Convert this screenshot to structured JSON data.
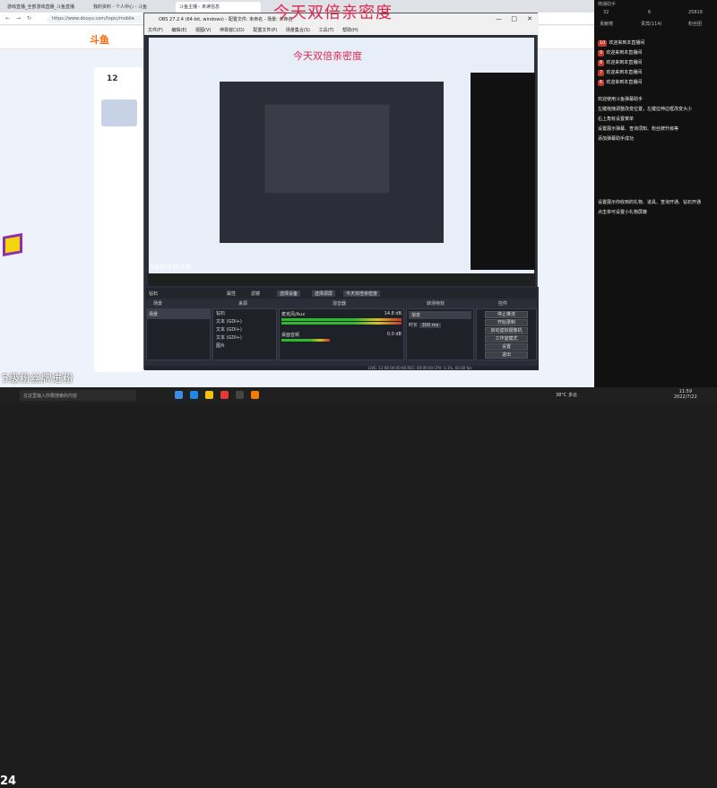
{
  "browser": {
    "tabs": [
      "游戏直播_全部游戏直播_斗鱼直播",
      "我的资料 - 个人中心 - 斗鱼",
      "斗鱼主播 - 未读信息"
    ],
    "url": "https://www.douyu.com/topic/mobile",
    "site_logo": "斗鱼",
    "card_number": "12"
  },
  "overlay": {
    "title": "今天双倍亲密度",
    "fans_banner": "5级粉丝牌进粉",
    "corner_number": "24"
  },
  "obs": {
    "title": "OBS 27.2.4 (64-bit, windows) - 配置文件: 未命名 - 场景: 未命名",
    "menu": [
      "文件(F)",
      "编辑(E)",
      "视图(V)",
      "停靠窗口(D)",
      "配置文件(P)",
      "场景集合(S)",
      "工具(T)",
      "帮助(H)"
    ],
    "preview_caption": "今天双倍亲密度",
    "preview_fans": "5级粉丝牌进粉",
    "toolbar": {
      "label": "钻石",
      "props": "属性",
      "filters": "滤镜",
      "transition_a": "选择设备",
      "transition_b": "选择源屏",
      "ext": "今天双倍亲密度"
    },
    "docks": {
      "scenes": "场景",
      "sources": "来源",
      "mixer": "混音器",
      "transitions": "转场特效",
      "controls": "控件"
    },
    "scene_item": "场景",
    "sources": [
      "钻石",
      "文本 (GDI+)",
      "文本 (GDI+)",
      "文本 (GDI+)",
      "图片"
    ],
    "mixer": [
      {
        "name": "麦克风/Aux",
        "db": "14.8 dB"
      },
      {
        "name": "桌面音频",
        "db": "0.0 dB"
      }
    ],
    "transition": {
      "type": "渐变",
      "duration_label": "时长",
      "duration": "300 ms"
    },
    "buttons": [
      "停止推流",
      "开始录制",
      "启动虚拟摄像机",
      "工作室模式",
      "设置",
      "退出"
    ],
    "status": "LIVE: 12:08  00:00:00   REC: 00:00:00   CPU: 3.1%, 60.00 fps"
  },
  "chat": {
    "header": "微播助手",
    "counts": [
      "32",
      "6",
      "25818"
    ],
    "tabs": [
      "贡献榜",
      "贵宾(114)",
      "粉丝团"
    ],
    "lines": [
      {
        "badge": "10",
        "text": "欢迎来到本直播间"
      },
      {
        "badge": "9",
        "text": "欢迎来到本直播间"
      },
      {
        "badge": "8",
        "text": "欢迎来到本直播间"
      },
      {
        "badge": "7",
        "text": "欢迎来到本直播间"
      },
      {
        "badge": "6",
        "text": "欢迎来到本直播间"
      }
    ],
    "notice": [
      "欢迎使用斗鱼弹幕助手",
      "左键拖拽调整改变位置，左键拉伸边框改变大小",
      "右上角有设置菜单",
      "设置展示弹幕、查询须知、粉丝牌升级等",
      "添加弹幕助手成功"
    ],
    "notice2": [
      "设置展示你收到的礼物、道具、查询开通、钻石开通",
      "点击单可设置小礼物屏蔽"
    ]
  },
  "taskbar": {
    "search": "在这里输入你要搜索的内容",
    "weather": "38°C 多云",
    "time": "11:59",
    "date": "2022/7/22"
  }
}
